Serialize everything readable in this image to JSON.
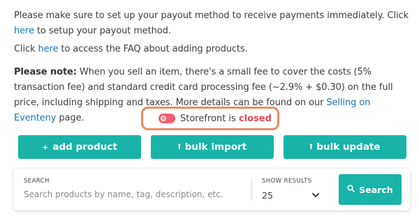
{
  "notice": {
    "payout_pre": "Please make sure to set up your payout method to receive payments immediately. Click ",
    "payout_link": "here",
    "payout_post": " to setup your payout method.",
    "faq_pre": "Click ",
    "faq_link": "here",
    "faq_post": " to access the FAQ about adding products.",
    "fee_label": "Please note:",
    "fee_text": " When you sell an item, there's a small fee to cover the costs (5% transaction fee) and standard credit card processing fee (~2.9% + $0.30) on the full price, including shipping and taxes. More details can be found on our ",
    "fee_link": "Selling on Eventeny",
    "fee_post": " page."
  },
  "storefront": {
    "label": "Storefront is",
    "status": "closed",
    "toggle_on": false,
    "status_color": "#e8475a",
    "highlight_color": "#ee8a63"
  },
  "actions": {
    "add_icon": "+",
    "add_label": "add product",
    "import_icon": "⭱",
    "import_label": "bulk import",
    "update_icon": "⭱",
    "update_label": "bulk update",
    "accent_color": "#19b3a9"
  },
  "search": {
    "label": "SEARCH",
    "placeholder": "Search products by name, tag, description, etc.",
    "value": "",
    "show_label": "SHOW RESULTS",
    "show_value": "25",
    "chevron_icon": "chevron-down-icon",
    "button_icon": "magnifier-icon",
    "button_label": "Search"
  }
}
